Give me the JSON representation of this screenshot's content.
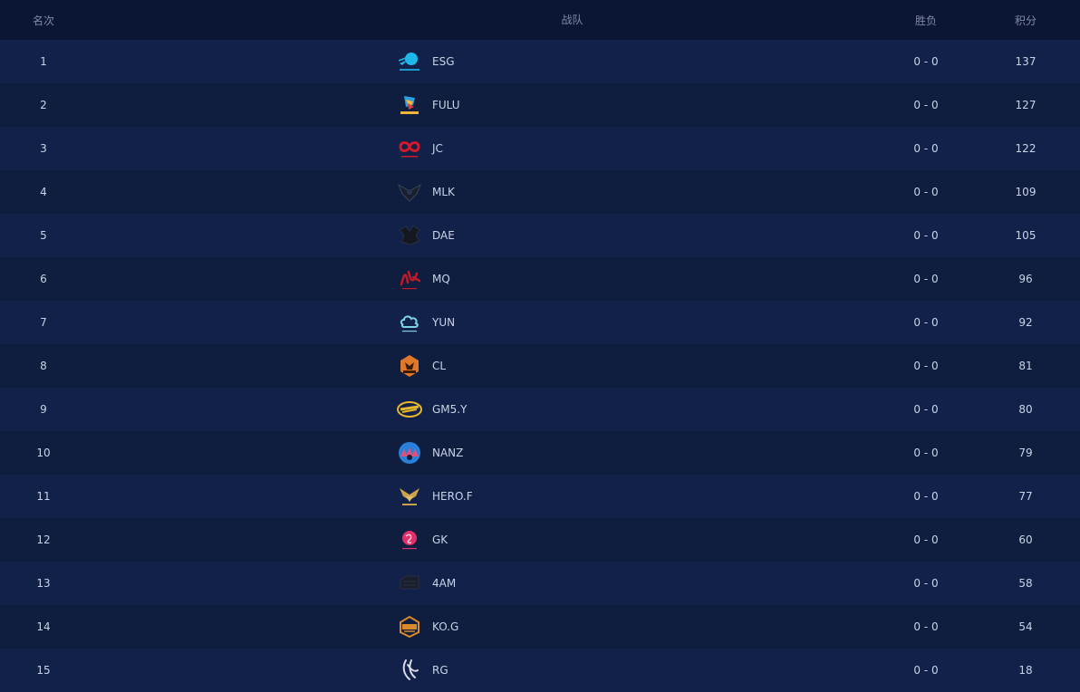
{
  "header": {
    "rank": "名次",
    "team": "战队",
    "winloss": "胜负",
    "points": "积分"
  },
  "rows": [
    {
      "rank": "1",
      "team": "ESG",
      "winloss": "0 - 0",
      "points": "137",
      "logo": "comet-logo-icon",
      "color": "#1fb6e8"
    },
    {
      "rank": "2",
      "team": "FULU",
      "winloss": "0 - 0",
      "points": "127",
      "logo": "colorful-bird-logo-icon",
      "color": "#f2b53a"
    },
    {
      "rank": "3",
      "team": "JC",
      "winloss": "0 - 0",
      "points": "122",
      "logo": "red-infinity-logo-icon",
      "color": "#d11a2a"
    },
    {
      "rank": "4",
      "team": "MLK",
      "winloss": "0 - 0",
      "points": "109",
      "logo": "dark-wings-logo-icon",
      "color": "#1a1f2c"
    },
    {
      "rank": "5",
      "team": "DAE",
      "winloss": "0 - 0",
      "points": "105",
      "logo": "dark-dragon-logo-icon",
      "color": "#151821"
    },
    {
      "rank": "6",
      "team": "MQ",
      "winloss": "0 - 0",
      "points": "96",
      "logo": "red-calligraphy-logo-icon",
      "color": "#c01a2a"
    },
    {
      "rank": "7",
      "team": "YUN",
      "winloss": "0 - 0",
      "points": "92",
      "logo": "cloud-logo-icon",
      "color": "#7fd0e8"
    },
    {
      "rank": "8",
      "team": "CL",
      "winloss": "0 - 0",
      "points": "81",
      "logo": "tiger-badge-logo-icon",
      "color": "#e0782a"
    },
    {
      "rank": "9",
      "team": "GM5.Y",
      "winloss": "0 - 0",
      "points": "80",
      "logo": "gm5-wordmark-logo-icon",
      "color": "#e6b82a"
    },
    {
      "rank": "10",
      "team": "NANZ",
      "winloss": "0 - 0",
      "points": "79",
      "logo": "round-skyline-logo-icon",
      "color": "#e0507a"
    },
    {
      "rank": "11",
      "team": "HERO.F",
      "winloss": "0 - 0",
      "points": "77",
      "logo": "gold-wings-logo-icon",
      "color": "#c9a24a"
    },
    {
      "rank": "12",
      "team": "GK",
      "winloss": "0 - 0",
      "points": "60",
      "logo": "pink-swirl-logo-icon",
      "color": "#e0306a"
    },
    {
      "rank": "13",
      "team": "4AM",
      "winloss": "0 - 0",
      "points": "58",
      "logo": "dark-block-logo-icon",
      "color": "#1a1f2c"
    },
    {
      "rank": "14",
      "team": "KO.G",
      "winloss": "0 - 0",
      "points": "54",
      "logo": "kog-badge-logo-icon",
      "color": "#d98a2a"
    },
    {
      "rank": "15",
      "team": "RG",
      "winloss": "0 - 0",
      "points": "18",
      "logo": "white-claw-logo-icon",
      "color": "#d8dde8"
    }
  ]
}
